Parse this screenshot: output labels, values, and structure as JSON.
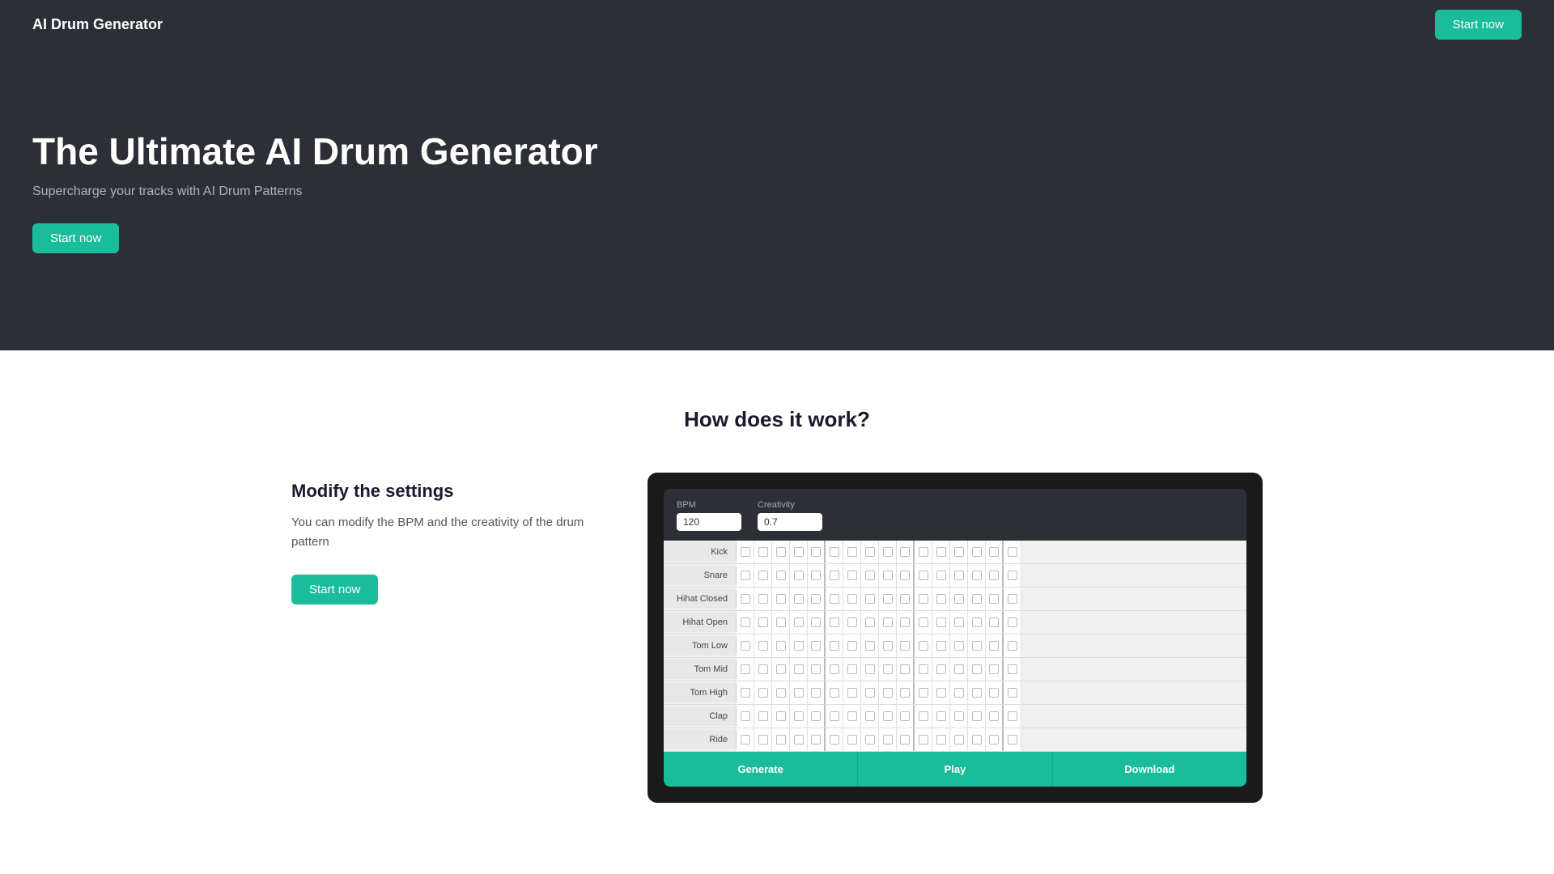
{
  "nav": {
    "logo": "AI Drum Generator",
    "cta_label": "Start now"
  },
  "hero": {
    "title": "The Ultimate AI Drum Generator",
    "subtitle": "Supercharge your tracks with AI Drum Patterns",
    "cta_label": "Start now"
  },
  "how": {
    "section_title": "How does it work?",
    "block1": {
      "heading": "Modify the settings",
      "description": "You can modify the BPM and the creativity of the drum pattern",
      "cta_label": "Start now"
    }
  },
  "drum_machine": {
    "bpm_label": "BPM",
    "bpm_value": "120",
    "creativity_label": "Creativity",
    "creativity_value": "0.7",
    "rows": [
      {
        "label": "Kick"
      },
      {
        "label": "Snare"
      },
      {
        "label": "Hihat Closed"
      },
      {
        "label": "Hihat Open"
      },
      {
        "label": "Tom Low"
      },
      {
        "label": "Tom Mid"
      },
      {
        "label": "Tom High"
      },
      {
        "label": "Clap"
      },
      {
        "label": "Ride"
      }
    ],
    "buttons": [
      "Generate",
      "Play",
      "Download"
    ],
    "steps": 16
  }
}
